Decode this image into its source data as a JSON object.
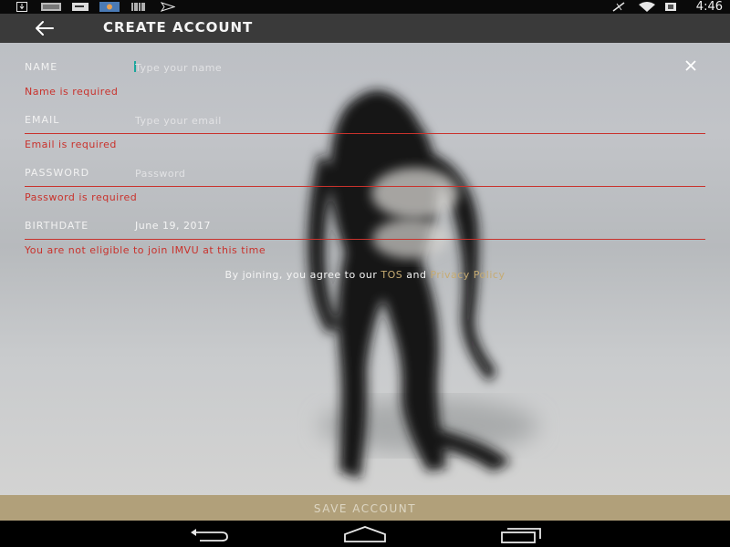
{
  "status_bar": {
    "time": "4:46"
  },
  "app_bar": {
    "title": "CREATE ACCOUNT"
  },
  "form": {
    "name": {
      "label": "NAME",
      "value": "",
      "placeholder": "Type your name",
      "error": "Name is required"
    },
    "email": {
      "label": "EMAIL",
      "value": "",
      "placeholder": "Type your email",
      "error": "Email is required"
    },
    "password": {
      "label": "PASSWORD",
      "value": "",
      "placeholder": "Password",
      "error": "Password is required"
    },
    "birthdate": {
      "label": "BIRTHDATE",
      "value": "June 19, 2017",
      "error": "You are not eligible to join IMVU at this time"
    }
  },
  "terms": {
    "prefix": "By joining, you agree to our ",
    "tos": "TOS",
    "and": " and ",
    "privacy": "Privacy Policy"
  },
  "save_button": {
    "label": "SAVE ACCOUNT"
  },
  "colors": {
    "error": "#c9322c",
    "accent": "#b1a07a",
    "link": "#c6ab72",
    "app_bar": "#3a3a3a"
  }
}
